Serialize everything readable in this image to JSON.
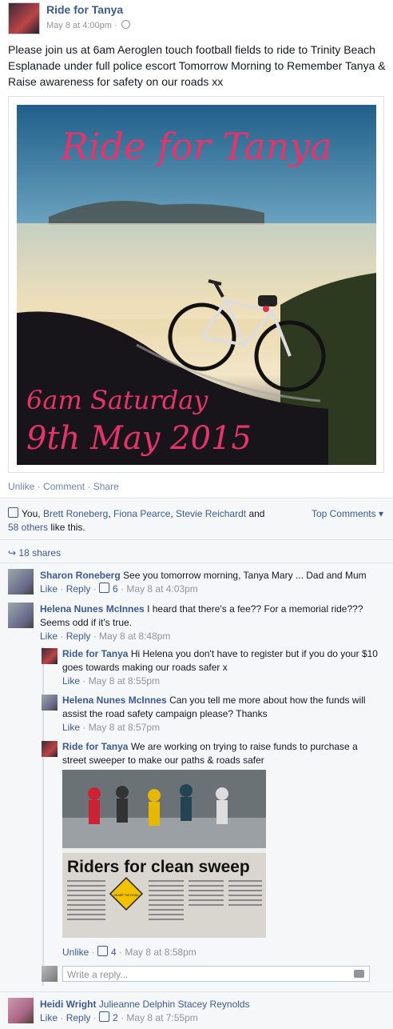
{
  "post": {
    "page_name": "Ride for Tanya",
    "date": "May 8 at 4:00pm",
    "separator": "·",
    "text": "Please join us at 6am Aeroglen touch football fields to ride to Trinity Beach Esplanade under full police escort Tomorrow Morning to Remember Tanya & Raise awareness for safety on our roads xx",
    "image": {
      "title": "Ride for Tanya",
      "line1": "6am Saturday",
      "line2": "9th May 2015"
    }
  },
  "actions": {
    "unlike": "Unlike",
    "comment": "Comment",
    "share": "Share",
    "dot": "·"
  },
  "likes": {
    "you": "You,",
    "names": [
      "Brett Roneberg",
      "Fiona Pearce",
      "Stevie Reichardt"
    ],
    "and": "and",
    "others": "58 others",
    "suffix": "like this.",
    "top_comments": "Top Comments ▾"
  },
  "shares": {
    "label": "18 shares"
  },
  "comments": [
    {
      "name": "Sharon Roneberg",
      "text": "See you tomorrow morning, Tanya Mary ... Dad and Mum",
      "like": "Like",
      "reply": "Reply",
      "likes": "6",
      "time": "May 8 at 4:03pm"
    },
    {
      "name": "Helena Nunes McInnes",
      "text": "I heard that there's a fee?? For a memorial ride??? Seems odd if it's true.",
      "like": "Like",
      "reply": "Reply",
      "time": "May 8 at 8:48pm"
    }
  ],
  "replies": [
    {
      "name": "Ride for Tanya",
      "text": "Hi Helena you don't have to register but if you do your $10 goes towards making our roads safer x",
      "like": "Like",
      "time": "May 8 at 8:55pm"
    },
    {
      "name": "Helena Nunes McInnes",
      "text": "Can you tell me more about how the funds will assist the road safety campaign please? Thanks",
      "like": "Like",
      "time": "May 8 at 8:57pm"
    },
    {
      "name": "Ride for Tanya",
      "text": "We are working on trying to raise funds to purchase a street sweeper to make our paths & roads safer",
      "like": "Unlike",
      "likes": "4",
      "time": "May 8 at 8:58pm"
    }
  ],
  "newspaper": {
    "headline": "Riders for clean sweep",
    "sign": "SHARE THE ROAD"
  },
  "write_reply": {
    "placeholder": "Write a reply..."
  },
  "last_comment": {
    "name": "Heidi Wright",
    "text": "Julieanne Delphin Stacey Reynolds",
    "like": "Like",
    "reply": "Reply",
    "likes": "2",
    "time": "May 8 at 7:55pm"
  }
}
